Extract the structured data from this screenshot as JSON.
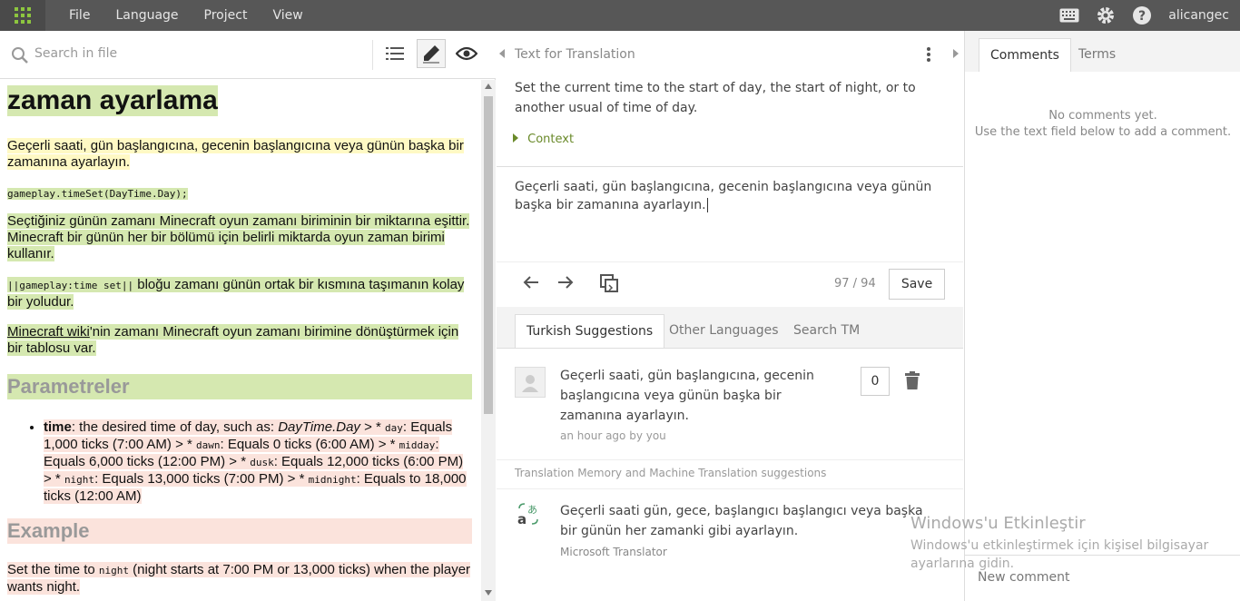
{
  "topbar": {
    "menu": [
      "File",
      "Language",
      "Project",
      "View"
    ],
    "user": "alicangec"
  },
  "left": {
    "search_placeholder": "Search in file",
    "doc": {
      "heading": "zaman ayarlama",
      "p1": "Geçerli saati, gün başlangıcına, gecenin başlangıcına veya günün başka bir zamanına ayarlayın.",
      "code1": "gameplay.timeSet(DayTime.Day);",
      "p2": "Seçtiğiniz günün zamanı Minecraft oyun zamanı biriminin bir miktarına eşittir. Minecraft bir günün her bir bölümü için belirli miktarda oyun zaman birimi kullanır.",
      "p3_code": "||gameplay:time set||",
      "p3_text": " bloğu zamanı günün ortak bir kısmına taşımanın kolay bir yoludur.",
      "p4_link": "Minecraft wiki",
      "p4_text": "'nin zamanı Minecraft oyun zamanı birimine dönüştürmek için bir tablosu var.",
      "h2_params": "Parametreler",
      "li_term": "time",
      "li_text1": ": the desired time of day, such as: ",
      "li_em": "DayTime.Day",
      "li_text2": " > * ",
      "li_day": "day",
      "li_text3": ": Equals 1,000 ticks (7:00 AM) > * ",
      "li_dawn": "dawn",
      "li_text4": ": Equals 0 ticks (6:00 AM) > * ",
      "li_midday": "midday",
      "li_text5": ": Equals 6,000 ticks (12:00 PM) > * ",
      "li_dusk": "dusk",
      "li_text6": ": Equals 12,000 ticks (6:00 PM) > * ",
      "li_night": "night",
      "li_text7": ": Equals 13,000 ticks (7:00 PM) > * ",
      "li_midnight": "midnight",
      "li_text8": ": Equals to 18,000 ticks (12:00 AM)",
      "h2_example": "Example",
      "ex_text1": "Set the time to ",
      "ex_code": "night",
      "ex_text2": " (night starts at 7:00 PM or 13,000 ticks) when the player wants night."
    }
  },
  "mid": {
    "title": "Text for Translation",
    "source": "Set the current time to the start of day, the start of night, or to another usual of time of day.",
    "context": "Context",
    "translation": "Geçerli saati, gün başlangıcına, gecenin başlangıcına veya günün başka bir zamanına ayarlayın.",
    "counter": "97 / 94",
    "save": "Save",
    "tabs": [
      "Turkish Suggestions",
      "Other Languages",
      "Search TM"
    ],
    "suggestion": {
      "text": "Geçerli saati, gün başlangıcına, gecenin başlangıcına veya günün başka bir zamanına ayarlayın.",
      "meta": "an hour ago by you",
      "votes": "0"
    },
    "tm_title": "Translation Memory and Machine Translation suggestions",
    "mt": {
      "text": "Geçerli saati gün, gece, başlangıcı başlangıcı veya başka bir günün her zamanki gibi ayarlayın.",
      "source": "Microsoft Translator"
    }
  },
  "right": {
    "tabs": [
      "Comments",
      "Terms"
    ],
    "no_comments_1": "No comments yet.",
    "no_comments_2": "Use the text field below to add a comment.",
    "new_comment": "New comment"
  },
  "watermark": {
    "title": "Windows'u Etkinleştir",
    "line1": "Windows'u etkinleştirmek için kişisel bilgisayar",
    "line2": "ayarlarına gidin."
  }
}
